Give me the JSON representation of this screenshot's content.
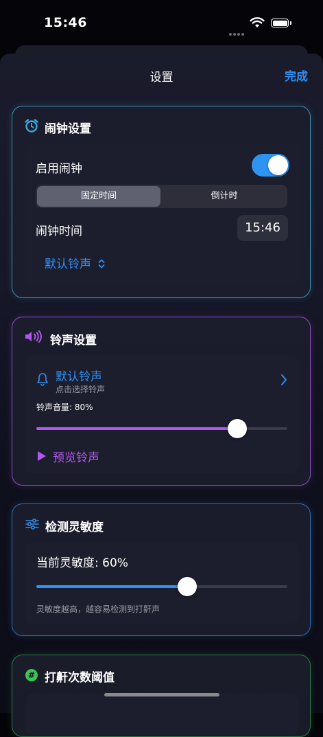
{
  "status": {
    "time": "15:46"
  },
  "nav": {
    "title": "设置",
    "done": "完成"
  },
  "alarm_card": {
    "title": "闹钟设置",
    "enable_label": "启用闹钟",
    "enabled": true,
    "segments": [
      "固定时间",
      "倒计时"
    ],
    "selected_segment": "固定时间",
    "time_label": "闹钟时间",
    "time_value": "15:46",
    "sound_picker": "默认铃声"
  },
  "ringtone_card": {
    "title": "铃声设置",
    "ringtone_name": "默认铃声",
    "ringtone_hint": "点击选择铃声",
    "volume_label": "铃声音量: 80%",
    "volume": 0.8,
    "preview": "预览铃声"
  },
  "sensitivity_card": {
    "title": "检测灵敏度",
    "current": "当前灵敏度: 60%",
    "level": 0.6,
    "hint": "灵敏度越高，越容易检测到打鼾声"
  },
  "threshold_card": {
    "title": "打鼾次数阈值"
  },
  "colors": {
    "blue": "#2f8ff3",
    "purple": "#b258f0",
    "cyan": "#3aa8e6",
    "green": "#3cc25a"
  }
}
